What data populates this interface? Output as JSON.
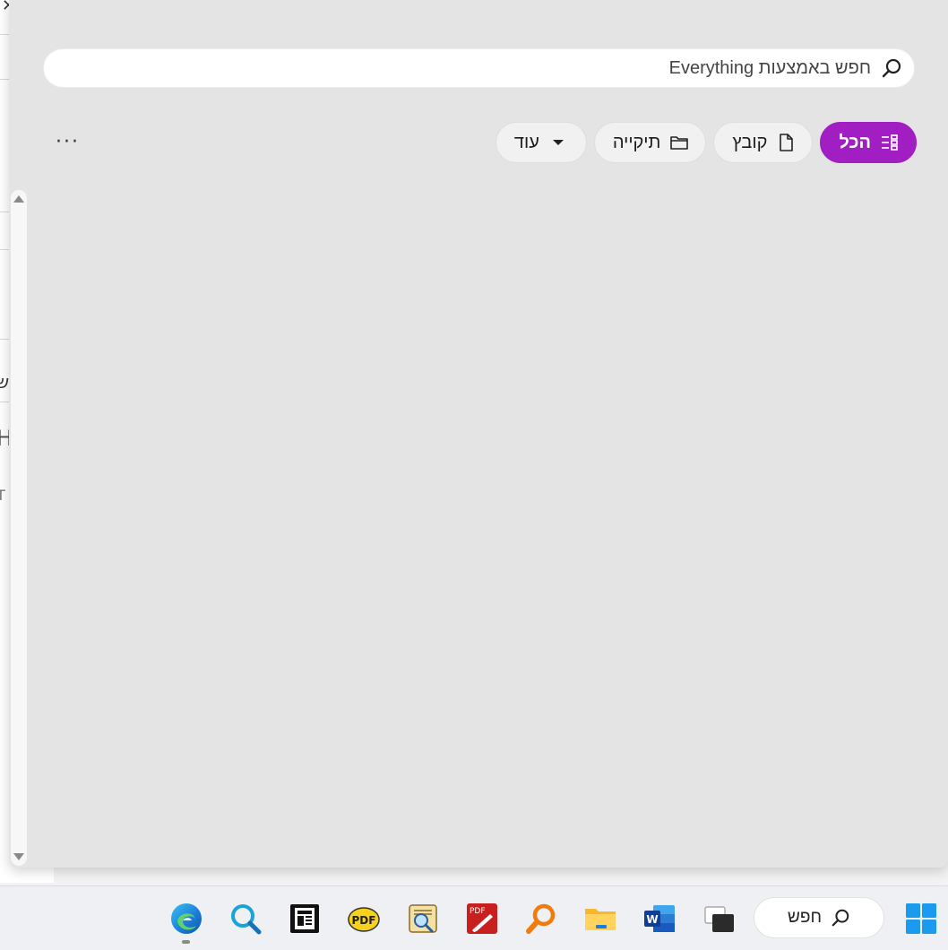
{
  "background_app": {
    "fragments": [
      "ש",
      "H",
      "T"
    ]
  },
  "search": {
    "placeholder": "חפש באמצעות Everything",
    "icon": "search-icon"
  },
  "filters": [
    {
      "label": "הכל",
      "icon": "list-icon",
      "active": true
    },
    {
      "label": "קובץ",
      "icon": "file-icon",
      "active": false
    },
    {
      "label": "תיקייה",
      "icon": "folder-icon",
      "active": false
    },
    {
      "label": "עוד",
      "icon": "caret-down-icon",
      "active": false
    }
  ],
  "more_options": {
    "label": "···"
  },
  "colors": {
    "accent": "#a11ec3",
    "panel_bg": "#e4e4e4",
    "taskbar_bg": "#eef0f4"
  },
  "taskbar": {
    "search_label": "חפש",
    "apps": [
      "edge-icon",
      "search-app-icon",
      "news-icon",
      "pdf-reader-icon",
      "document-viewer-icon",
      "pdf-editor-icon",
      "magnifier-icon",
      "file-explorer-icon",
      "word-icon",
      "task-view-icon"
    ],
    "start_icon": "windows-start-icon"
  }
}
